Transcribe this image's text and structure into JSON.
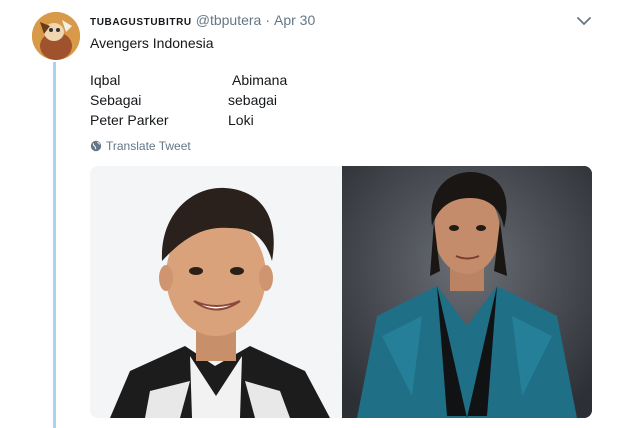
{
  "tweet": {
    "display_name": "TUBAGUSTUBITRU",
    "handle": "@tbputera",
    "separator": "·",
    "time": "Apr 30",
    "text": "Avengers Indonesia",
    "left_column": [
      "Iqbal",
      "Sebagai",
      "Peter Parker"
    ],
    "right_column": [
      "Abimana",
      "sebagai",
      "Loki"
    ],
    "translate_label": "Translate Tweet"
  },
  "colors": {
    "thread_line": "#a8d4ec",
    "secondary_text": "#657786",
    "primary_text": "#14171a"
  },
  "icons": {
    "caret": "chevron-down-icon",
    "translate": "globe-icon"
  },
  "media": {
    "images": [
      "photo-iqbal",
      "photo-abimana"
    ]
  }
}
